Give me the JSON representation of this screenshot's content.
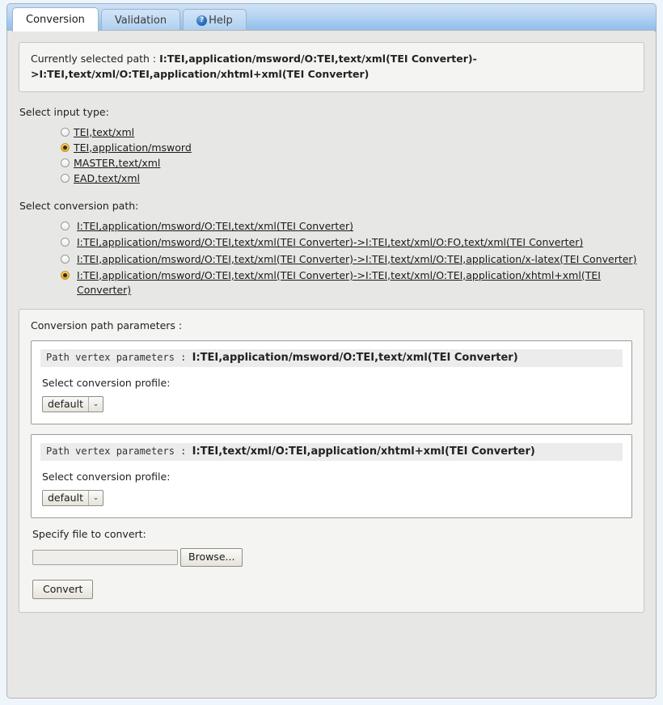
{
  "tabs": [
    {
      "label": "Conversion",
      "active": true,
      "icon": null
    },
    {
      "label": "Validation",
      "active": false,
      "icon": null
    },
    {
      "label": "Help",
      "active": false,
      "icon": "help-circle-icon",
      "icon_glyph": "?"
    }
  ],
  "selected_path": {
    "label": "Currently selected path : ",
    "value": "I:TEI,application/msword/O:TEI,text/xml(TEI Converter)->I:TEI,text/xml/O:TEI,application/xhtml+xml(TEI Converter)"
  },
  "input_type": {
    "label": "Select input type:",
    "options": [
      {
        "label": "TEI,text/xml",
        "checked": false
      },
      {
        "label": "TEI,application/msword",
        "checked": true
      },
      {
        "label": "MASTER,text/xml",
        "checked": false
      },
      {
        "label": "EAD,text/xml",
        "checked": false
      }
    ]
  },
  "conversion_path": {
    "label": "Select conversion path:",
    "options": [
      {
        "label": "I:TEI,application/msword/O:TEI,text/xml(TEI Converter)",
        "checked": false
      },
      {
        "label": "I:TEI,application/msword/O:TEI,text/xml(TEI Converter)->I:TEI,text/xml/O:FO,text/xml(TEI Converter)",
        "checked": false
      },
      {
        "label": "I:TEI,application/msword/O:TEI,text/xml(TEI Converter)->I:TEI,text/xml/O:TEI,application/x-latex(TEI Converter)",
        "checked": false
      },
      {
        "label": "I:TEI,application/msword/O:TEI,text/xml(TEI Converter)->I:TEI,text/xml/O:TEI,application/xhtml+xml(TEI Converter)",
        "checked": true
      }
    ]
  },
  "params": {
    "title": "Conversion path parameters :",
    "vertices": [
      {
        "header_label": "Path vertex parameters : ",
        "header_value": "I:TEI,application/msword/O:TEI,text/xml(TEI Converter)",
        "profile_label": "Select conversion profile:",
        "profile_value": "default",
        "profile_options": [
          "default"
        ]
      },
      {
        "header_label": "Path vertex parameters : ",
        "header_value": "I:TEI,text/xml/O:TEI,application/xhtml+xml(TEI Converter)",
        "profile_label": "Select conversion profile:",
        "profile_value": "default",
        "profile_options": [
          "default"
        ]
      }
    ],
    "file": {
      "label": "Specify file to convert:",
      "value": "",
      "placeholder": "",
      "browse_label": "Browse..."
    },
    "convert_label": "Convert"
  },
  "icons": {
    "chevron_down": "⌄"
  },
  "colors": {
    "tab_active_bg": "#ffffff",
    "tabstrip_blue": "#9ec6ee",
    "panel_bg": "#e7e7e6",
    "radio_checked": "#e8a81c",
    "page_bg": "#eef5fb"
  }
}
